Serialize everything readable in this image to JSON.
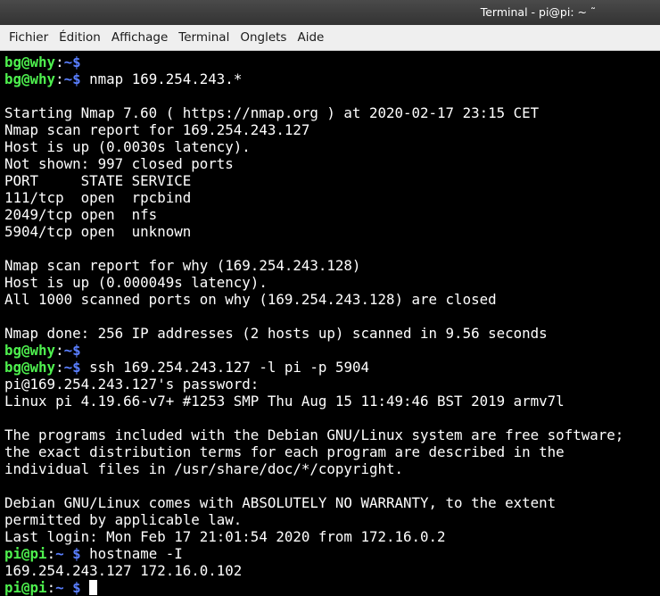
{
  "window": {
    "title": "Terminal - pi@pi: ~",
    "title_chevron": "˜"
  },
  "menu": [
    {
      "label": "Fichier"
    },
    {
      "label": "Édition"
    },
    {
      "label": "Affichage"
    },
    {
      "label": "Terminal"
    },
    {
      "label": "Onglets"
    },
    {
      "label": "Aide"
    }
  ],
  "terminal": {
    "lines": [
      {
        "type": "prompt",
        "user": "bg@why",
        "sep": ":",
        "path": "~",
        "sym": "$",
        "cmd": ""
      },
      {
        "type": "prompt",
        "user": "bg@why",
        "sep": ":",
        "path": "~",
        "sym": "$",
        "cmd": " nmap 169.254.243.*"
      },
      {
        "type": "text",
        "text": ""
      },
      {
        "type": "text",
        "text": "Starting Nmap 7.60 ( https://nmap.org ) at 2020-02-17 23:15 CET"
      },
      {
        "type": "text",
        "text": "Nmap scan report for 169.254.243.127"
      },
      {
        "type": "text",
        "text": "Host is up (0.0030s latency)."
      },
      {
        "type": "text",
        "text": "Not shown: 997 closed ports"
      },
      {
        "type": "text",
        "text": "PORT     STATE SERVICE"
      },
      {
        "type": "text",
        "text": "111/tcp  open  rpcbind"
      },
      {
        "type": "text",
        "text": "2049/tcp open  nfs"
      },
      {
        "type": "text",
        "text": "5904/tcp open  unknown"
      },
      {
        "type": "text",
        "text": ""
      },
      {
        "type": "text",
        "text": "Nmap scan report for why (169.254.243.128)"
      },
      {
        "type": "text",
        "text": "Host is up (0.000049s latency)."
      },
      {
        "type": "text",
        "text": "All 1000 scanned ports on why (169.254.243.128) are closed"
      },
      {
        "type": "text",
        "text": ""
      },
      {
        "type": "text",
        "text": "Nmap done: 256 IP addresses (2 hosts up) scanned in 9.56 seconds"
      },
      {
        "type": "prompt",
        "user": "bg@why",
        "sep": ":",
        "path": "~",
        "sym": "$",
        "cmd": ""
      },
      {
        "type": "prompt",
        "user": "bg@why",
        "sep": ":",
        "path": "~",
        "sym": "$",
        "cmd": " ssh 169.254.243.127 -l pi -p 5904"
      },
      {
        "type": "text",
        "text": "pi@169.254.243.127's password:"
      },
      {
        "type": "text",
        "text": "Linux pi 4.19.66-v7+ #1253 SMP Thu Aug 15 11:49:46 BST 2019 armv7l"
      },
      {
        "type": "text",
        "text": ""
      },
      {
        "type": "text",
        "text": "The programs included with the Debian GNU/Linux system are free software;"
      },
      {
        "type": "text",
        "text": "the exact distribution terms for each program are described in the"
      },
      {
        "type": "text",
        "text": "individual files in /usr/share/doc/*/copyright."
      },
      {
        "type": "text",
        "text": ""
      },
      {
        "type": "text",
        "text": "Debian GNU/Linux comes with ABSOLUTELY NO WARRANTY, to the extent"
      },
      {
        "type": "text",
        "text": "permitted by applicable law."
      },
      {
        "type": "text",
        "text": "Last login: Mon Feb 17 21:01:54 2020 from 172.16.0.2"
      },
      {
        "type": "prompt",
        "user": "pi@pi",
        "sep": ":",
        "path": "~",
        "sym": " $",
        "cmd": " hostname -I"
      },
      {
        "type": "text",
        "text": "169.254.243.127 172.16.0.102"
      },
      {
        "type": "prompt",
        "user": "pi@pi",
        "sep": ":",
        "path": "~",
        "sym": " $",
        "cmd": " ",
        "cursor": true
      }
    ]
  },
  "colors": {
    "prompt_user_bg": "#4ef04e",
    "prompt_path": "#5a7fff",
    "terminal_bg": "#000000",
    "terminal_fg": "#ffffff"
  }
}
